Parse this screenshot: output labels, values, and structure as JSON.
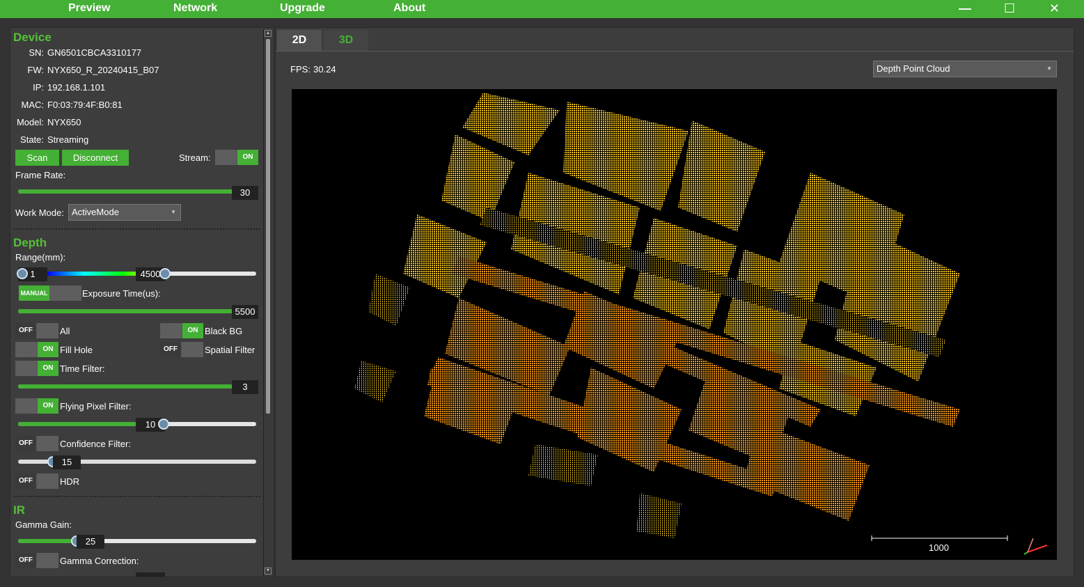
{
  "menu": {
    "preview": "Preview",
    "network": "Network",
    "upgrade": "Upgrade",
    "about": "About"
  },
  "window": {
    "minimize": "—",
    "maximize": "☐",
    "close": "✕"
  },
  "device": {
    "title": "Device",
    "sn_label": "SN:",
    "sn": "GN6501CBCA3310177",
    "fw_label": "FW:",
    "fw": "NYX650_R_20240415_B07",
    "ip_label": "IP:",
    "ip": "192.168.1.101",
    "mac_label": "MAC:",
    "mac": "F0:03:79:4F:B0:81",
    "model_label": "Model:",
    "model": "NYX650",
    "state_label": "State:",
    "state": "Streaming",
    "scan": "Scan",
    "disconnect": "Disconnect",
    "stream_label": "Stream:",
    "stream_state": "ON",
    "frame_rate_label": "Frame Rate:",
    "frame_rate": "30",
    "frame_rate_fraction": 1.0,
    "work_mode_label": "Work Mode:",
    "work_mode": "ActiveMode"
  },
  "depth": {
    "title": "Depth",
    "range_label": "Range(mm):",
    "range_min": "1",
    "range_max": "4500",
    "exposure_mode": "MANUAL",
    "exposure_label": "Exposure Time(us):",
    "exposure": "5500",
    "exposure_fraction": 1.0,
    "all_state": "OFF",
    "all_label": "All",
    "black_bg_state": "ON",
    "black_bg_label": "Black BG",
    "fill_hole_state": "ON",
    "fill_hole_label": "Fill Hole",
    "spatial_state": "OFF",
    "spatial_label": "Spatial Filter",
    "time_filter_state": "ON",
    "time_filter_label": "Time Filter:",
    "time_filter": "3",
    "time_filter_fraction": 1.0,
    "flying_state": "ON",
    "flying_label": "Flying Pixel Filter:",
    "flying": "10",
    "flying_fraction": 0.62,
    "confidence_state": "OFF",
    "confidence_label": "Confidence Filter:",
    "confidence": "15",
    "confidence_fraction": 0.15,
    "hdr_state": "OFF",
    "hdr_label": "HDR"
  },
  "ir": {
    "title": "IR",
    "gamma_gain_label": "Gamma Gain:",
    "gamma_gain": "25",
    "gamma_gain_fraction": 0.25,
    "gamma_corr_state": "OFF",
    "gamma_corr_label": "Gamma Correction:"
  },
  "view": {
    "tab_2d": "2D",
    "tab_3d": "3D",
    "fps_label": "FPS:",
    "fps": "30.24",
    "mode": "Depth Point Cloud",
    "scale": "1000"
  },
  "colors": {
    "accent": "#44b035",
    "point_yellow": "#f2c21a",
    "point_orange": "#f08c10"
  }
}
